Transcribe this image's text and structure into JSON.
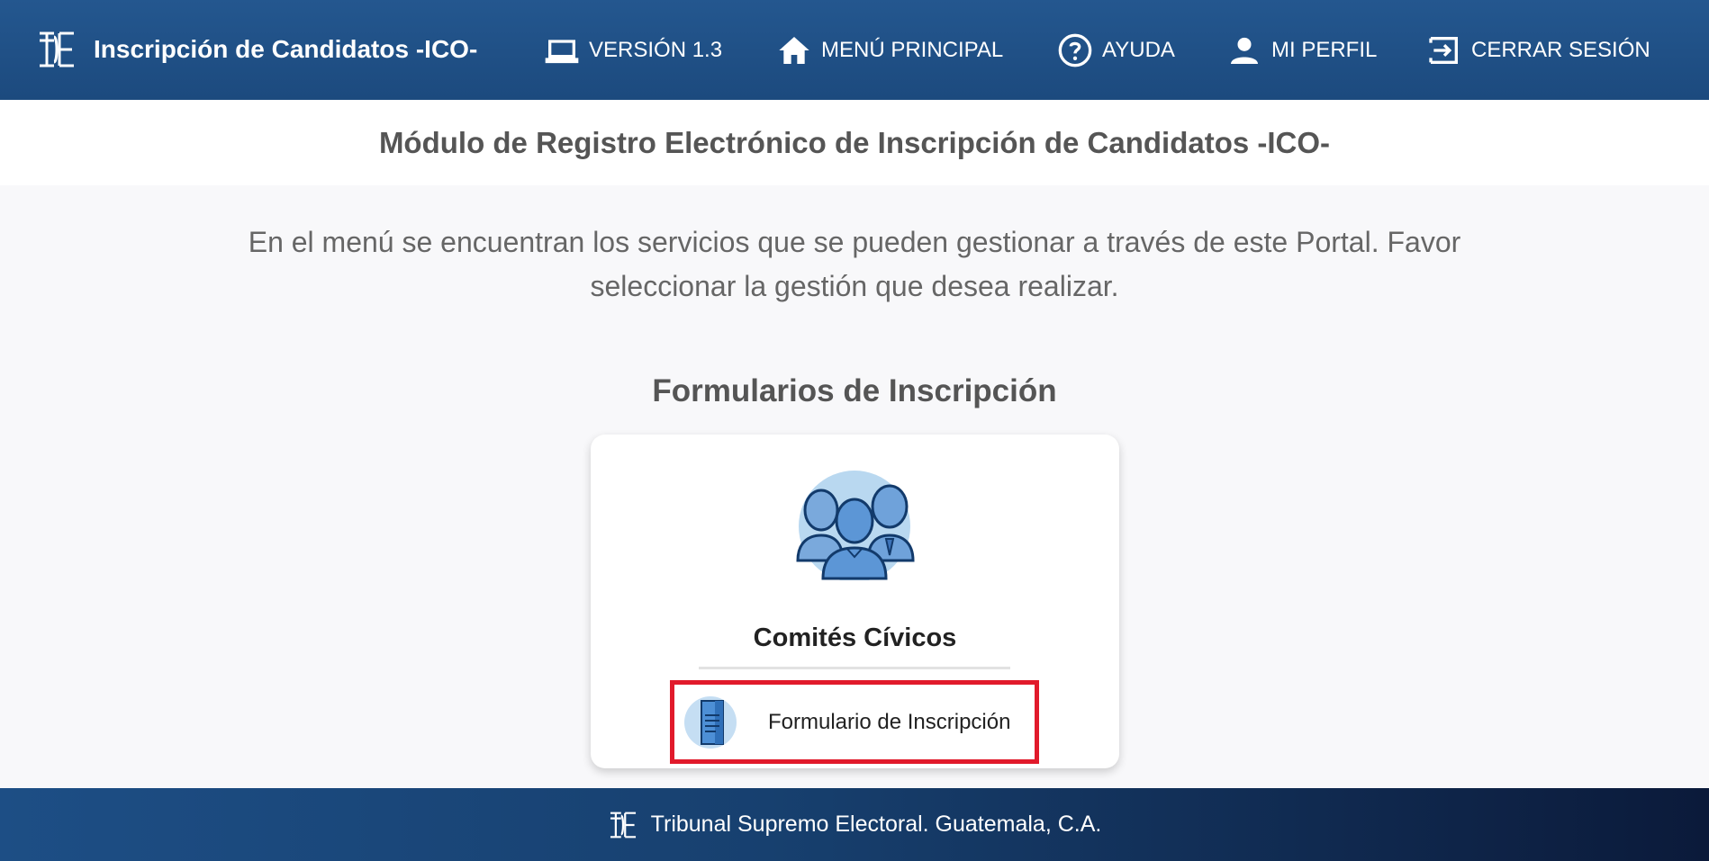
{
  "header": {
    "title": "Inscripción de Candidatos -ICO-",
    "nav": {
      "version": "VERSIÓN 1.3",
      "main_menu": "MENÚ PRINCIPAL",
      "help": "AYUDA",
      "profile": "MI PERFIL",
      "logout": "CERRAR SESIÓN"
    },
    "icons": {
      "logo": "tse-logo-icon",
      "version": "laptop-icon",
      "main_menu": "home-icon",
      "help": "help-circle-icon",
      "profile": "person-icon",
      "logout": "logout-icon"
    }
  },
  "subheader": {
    "title": "Módulo de Registro Electrónico de Inscripción de Candidatos -ICO-"
  },
  "main": {
    "intro": "En el menú se encuentran los servicios que se pueden gestionar a través de este Portal. Favor seleccionar la gestión que desea realizar.",
    "section_title": "Formularios de Inscripción",
    "card": {
      "title": "Comités Cívicos",
      "link_label": "Formulario de Inscripción",
      "illustration_icon": "people-group-icon",
      "link_icon": "document-icon"
    }
  },
  "footer": {
    "text": "Tribunal Supremo Electoral. Guatemala, C.A."
  },
  "colors": {
    "navbar": "#1f5189",
    "highlight_border": "#e11a2b",
    "footer_end": "#0b1a3a"
  }
}
